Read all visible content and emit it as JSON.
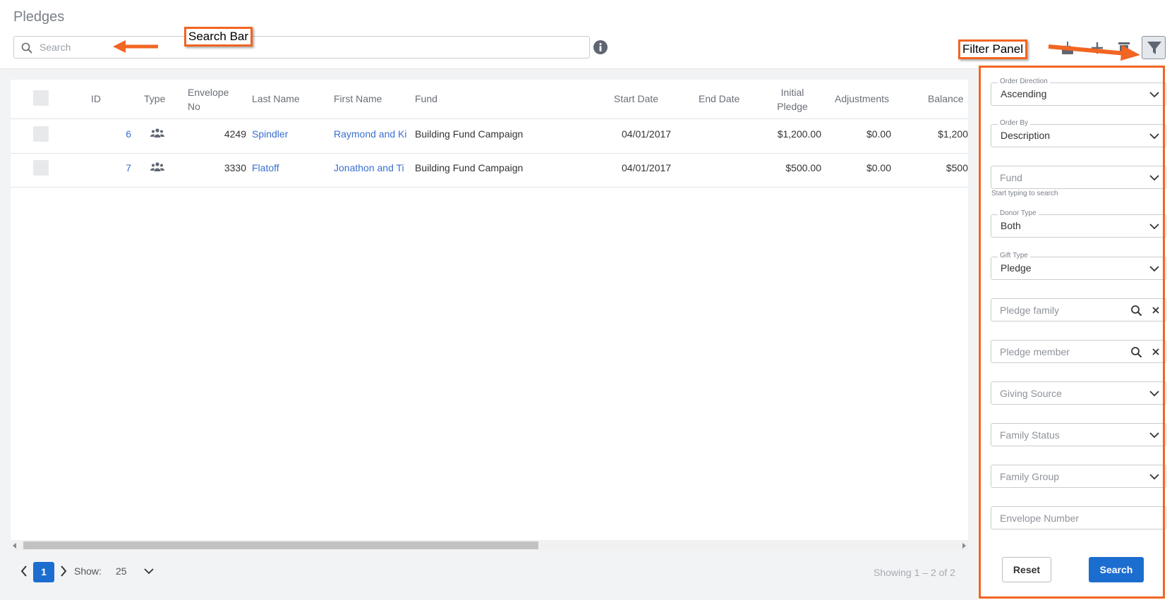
{
  "page": {
    "title": "Pledges"
  },
  "search": {
    "placeholder": "Search"
  },
  "toolbar": {
    "icons": [
      "download-icon",
      "add-icon",
      "delete-icon",
      "filter-icon"
    ],
    "info_icon": "info-icon"
  },
  "table": {
    "headers": {
      "id": "ID",
      "type": "Type",
      "envelope": "Envelope No",
      "last_name": "Last Name",
      "first_name": "First Name",
      "fund": "Fund",
      "start_date": "Start Date",
      "end_date": "End Date",
      "initial_pledge": "Initial Pledge",
      "adjustments": "Adjustments",
      "balance": "Balance"
    },
    "rows": [
      {
        "id": "6",
        "type_icon": "family-icon",
        "envelope": "4249",
        "last_name": "Spindler",
        "first_name": "Raymond and Ki",
        "fund": "Building Fund Campaign",
        "start_date": "04/01/2017",
        "end_date": "",
        "initial_pledge": "$1,200.00",
        "adjustments": "$0.00",
        "balance": "$1,200"
      },
      {
        "id": "7",
        "type_icon": "family-icon",
        "envelope": "3330",
        "last_name": "Flatoff",
        "first_name": "Jonathon and Ti",
        "fund": "Building Fund Campaign",
        "start_date": "04/01/2017",
        "end_date": "",
        "initial_pledge": "$500.00",
        "adjustments": "$0.00",
        "balance": "$500"
      }
    ]
  },
  "pagination": {
    "current_page": "1",
    "show_label": "Show:",
    "page_size": "25",
    "showing_text": "Showing 1 – 2 of 2"
  },
  "filters": {
    "order_direction": {
      "label": "Order Direction",
      "value": "Ascending"
    },
    "order_by": {
      "label": "Order By",
      "value": "Description"
    },
    "fund": {
      "placeholder": "Fund",
      "hint": "Start typing to search"
    },
    "donor_type": {
      "label": "Donor Type",
      "value": "Both"
    },
    "gift_type": {
      "label": "Gift Type",
      "value": "Pledge"
    },
    "pledge_family": {
      "placeholder": "Pledge family"
    },
    "pledge_member": {
      "placeholder": "Pledge member"
    },
    "giving_source": {
      "placeholder": "Giving Source"
    },
    "family_status": {
      "placeholder": "Family Status"
    },
    "family_group": {
      "placeholder": "Family Group"
    },
    "envelope_number": {
      "placeholder": "Envelope Number"
    },
    "reset_label": "Reset",
    "search_label": "Search"
  },
  "annotations": {
    "search_bar": "Search Bar",
    "filter_panel": "Filter Panel"
  },
  "colors": {
    "accent": "#1c6dd0",
    "annotation": "#f26522",
    "link": "#3b6fd1"
  }
}
